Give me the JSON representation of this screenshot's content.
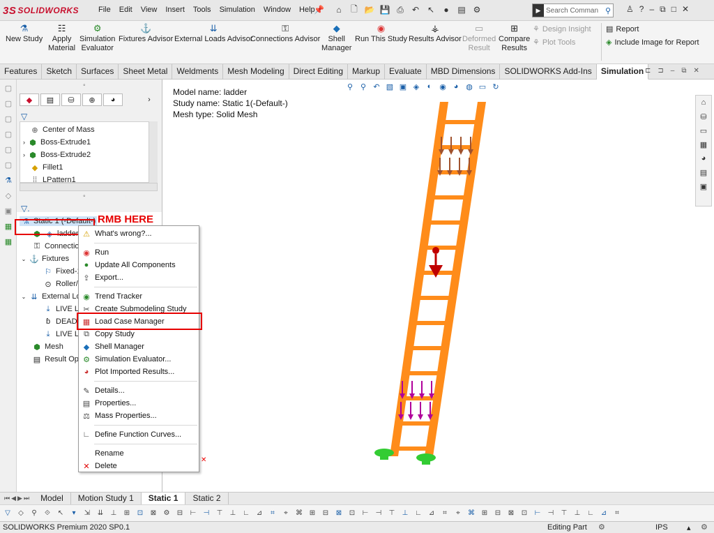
{
  "app": {
    "logo_text": "SOLIDWORKS",
    "logo_mark": "3S"
  },
  "menu": [
    "File",
    "Edit",
    "View",
    "Insert",
    "Tools",
    "Simulation",
    "Window",
    "Help"
  ],
  "search": {
    "placeholder": "Search Comman"
  },
  "ribbon": {
    "new_study": "New Study",
    "apply_material_1": "Apply",
    "apply_material_2": "Material",
    "sim_eval_1": "Simulation",
    "sim_eval_2": "Evaluator",
    "fixtures": "Fixtures Advisor",
    "external_loads": "External Loads Advisor",
    "connections": "Connections Advisor",
    "shell_1": "Shell",
    "shell_2": "Manager",
    "run": "Run This Study",
    "results": "Results Advisor",
    "deformed_1": "Deformed",
    "deformed_2": "Result",
    "compare_1": "Compare",
    "compare_2": "Results",
    "design_insight": "Design Insight",
    "plot_tools": "Plot Tools",
    "report": "Report",
    "include_image": "Include Image for Report"
  },
  "tabs": [
    "Features",
    "Sketch",
    "Surfaces",
    "Sheet Metal",
    "Weldments",
    "Mesh Modeling",
    "Direct Editing",
    "Markup",
    "Evaluate",
    "MBD Dimensions",
    "SOLIDWORKS Add-Ins",
    "Simulation"
  ],
  "feature_tree": {
    "items": [
      {
        "label": "Center of Mass",
        "icon": "center-of-mass-icon"
      },
      {
        "label": "Boss-Extrude1",
        "icon": "extrude-icon"
      },
      {
        "label": "Boss-Extrude2",
        "icon": "extrude-icon"
      },
      {
        "label": "Fillet1",
        "icon": "fillet-icon"
      },
      {
        "label": "LPattern1",
        "icon": "pattern-icon"
      }
    ]
  },
  "sim_tree": {
    "study": "Static 1 (-Default-)",
    "ladder": "ladder",
    "connections": "Connection",
    "fixtures": "Fixtures",
    "fixed": "Fixed-1",
    "roller": "Roller/S",
    "external": "External Lo",
    "live1": "LIVE L",
    "dead": "DEAD",
    "live2": "LIVE LC",
    "mesh": "Mesh",
    "result_opt": "Result Opt"
  },
  "annotation": {
    "rmb": "RMB HERE"
  },
  "context_menu": [
    {
      "label": "What's wrong?...",
      "icon": "warning-icon"
    },
    {
      "sep": true
    },
    {
      "label": "Run",
      "icon": "run-icon"
    },
    {
      "label": "Update All Components",
      "icon": "update-icon"
    },
    {
      "label": "Export...",
      "icon": "export-icon"
    },
    {
      "sep": true
    },
    {
      "label": "Trend Tracker",
      "icon": "trend-tracker-icon"
    },
    {
      "label": "Create Submodeling Study",
      "icon": "submodel-icon"
    },
    {
      "label": "Load Case Manager",
      "icon": "load-case-icon"
    },
    {
      "label": "Copy Study",
      "icon": "copy-icon"
    },
    {
      "label": "Shell Manager",
      "icon": "shell-icon"
    },
    {
      "label": "Simulation Evaluator...",
      "icon": "evaluator-icon"
    },
    {
      "label": "Plot Imported Results...",
      "icon": "plot-icon"
    },
    {
      "sep": true
    },
    {
      "label": "Details...",
      "icon": "details-icon"
    },
    {
      "label": "Properties...",
      "icon": "properties-icon"
    },
    {
      "label": "Mass Properties...",
      "icon": "mass-icon"
    },
    {
      "sep": true
    },
    {
      "label": "Define Function Curves...",
      "icon": "curve-icon"
    },
    {
      "sep": true
    },
    {
      "label": "Rename",
      "icon": ""
    },
    {
      "label": "Delete",
      "icon": "delete-icon"
    }
  ],
  "viewport": {
    "model_name": "Model name: ladder",
    "study_name": "Study name: Static 1(-Default-)",
    "mesh_type": "Mesh type: Solid Mesh"
  },
  "bottom_tabs": [
    "Model",
    "Motion Study 1",
    "Static 1",
    "Static 2"
  ],
  "status": {
    "left": "SOLIDWORKS Premium 2020 SP0.1",
    "editing": "Editing Part",
    "units": "IPS"
  },
  "colors": {
    "ladder": "#ff8c1a",
    "brown_load": "#a0522d",
    "magenta_load": "#b0009a",
    "gravity": "#c00000",
    "fixture": "#33cc33",
    "highlight": "#e60000"
  }
}
